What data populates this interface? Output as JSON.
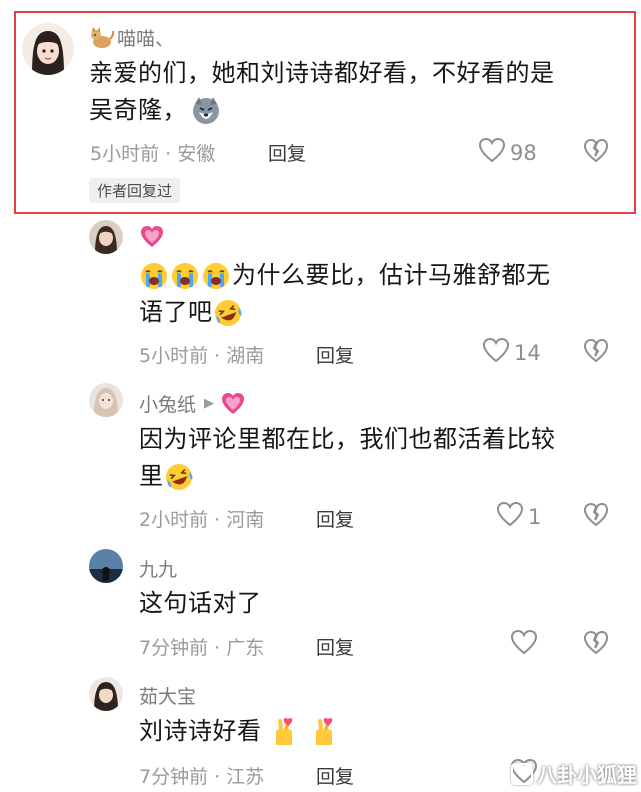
{
  "comments": [
    {
      "username": "喵喵、",
      "text_line1": "亲爱的们，她和刘诗诗都好看，不好看的是",
      "text_line2": "吴奇隆，",
      "time_location": "5小时前 · 安徽",
      "reply_label": "回复",
      "likes": "98",
      "author_badge": "作者回复过"
    },
    {
      "username": "",
      "text_line1": "为什么要比，估计马雅舒都无",
      "text_line2": "语了吧",
      "time_location": "5小时前 · 湖南",
      "reply_label": "回复",
      "likes": "14"
    },
    {
      "username": "小兔纸",
      "text_line1": "因为评论里都在比，我们也都活着比较",
      "text_line2": "里",
      "time_location": "2小时前 · 河南",
      "reply_label": "回复",
      "likes": "1"
    },
    {
      "username": "九九",
      "text_line1": "这句话对了",
      "time_location": "7分钟前 · 广东",
      "reply_label": "回复",
      "likes": ""
    },
    {
      "username": "茹大宝",
      "text_line1": "刘诗诗好看",
      "time_location": "7分钟前 · 江苏",
      "reply_label": "回复",
      "likes": ""
    }
  ],
  "watermark": "八卦小狐狸",
  "colors": {
    "highlight_border": "#e1413f",
    "heart_pink": "#e94a8f",
    "meta_gray": "#9a9a9a"
  },
  "icons": [
    "cat-icon",
    "pink-heart-icon",
    "crying-face-icon",
    "laughing-tears-icon",
    "husky-dog-icon",
    "finger-heart-icon",
    "like-heart-icon",
    "dislike-broken-heart-icon",
    "play-arrow-icon"
  ]
}
